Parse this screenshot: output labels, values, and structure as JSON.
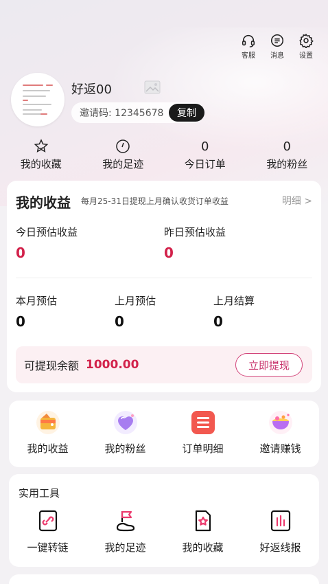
{
  "header": {
    "buttons": [
      {
        "label": "客服",
        "icon": "headset-icon"
      },
      {
        "label": "消息",
        "icon": "message-icon"
      },
      {
        "label": "设置",
        "icon": "gear-icon"
      }
    ]
  },
  "profile": {
    "username": "好返00",
    "invite_code": "邀请码: 12345678",
    "copy_label": "复制"
  },
  "stats": [
    {
      "value": "",
      "icon": "star-icon",
      "label": "我的收藏"
    },
    {
      "value": "",
      "icon": "clock-icon",
      "label": "我的足迹"
    },
    {
      "value": "0",
      "label": "今日订单"
    },
    {
      "value": "0",
      "label": "我的粉丝"
    }
  ],
  "earnings": {
    "title": "我的收益",
    "note": "每月25-31日提现上月确认收货订单收益",
    "detail_link": "明细 >",
    "today_label": "今日预估收益",
    "today_value": "0",
    "yesterday_label": "昨日预估收益",
    "yesterday_value": "0",
    "month_label": "本月预估",
    "month_value": "0",
    "last_month_label": "上月预估",
    "last_month_value": "0",
    "settled_label": "上月结算",
    "settled_value": "0",
    "balance_label": "可提现余额",
    "balance_value": "1000.00",
    "withdraw_label": "立即提现",
    "accent_color": "#d2214a"
  },
  "quick_menu": [
    {
      "label": "我的收益",
      "icon": "wallet-icon"
    },
    {
      "label": "我的粉丝",
      "icon": "heart-icon"
    },
    {
      "label": "订单明细",
      "icon": "order-list-icon"
    },
    {
      "label": "邀请赚钱",
      "icon": "gift-bowl-icon"
    }
  ],
  "tools": {
    "title": "实用工具",
    "items": [
      {
        "label": "一键转链",
        "icon": "link-icon"
      },
      {
        "label": "我的足迹",
        "icon": "flag-icon"
      },
      {
        "label": "我的收藏",
        "icon": "star-doc-icon"
      },
      {
        "label": "好返线报",
        "icon": "chart-icon"
      }
    ]
  }
}
